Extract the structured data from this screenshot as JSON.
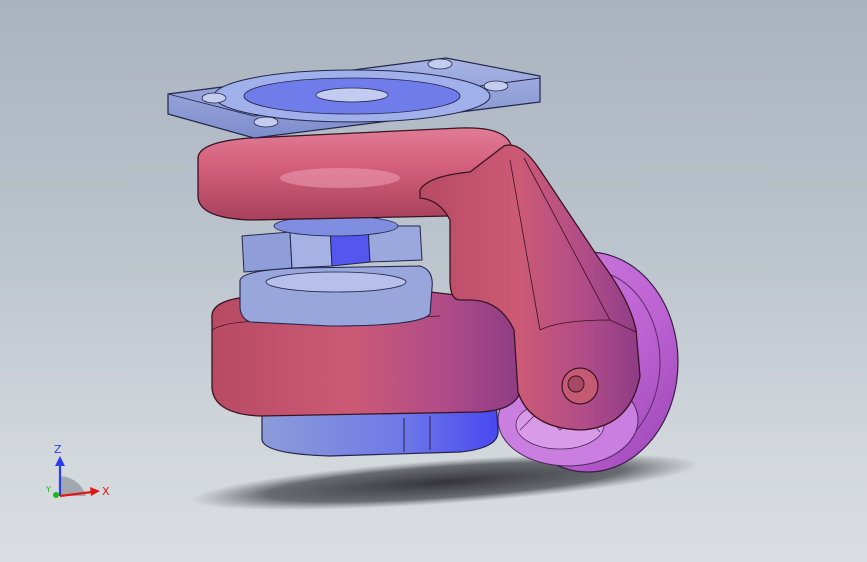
{
  "viewport": {
    "background_top": "#a9b3bf",
    "background_bottom": "#dadee2"
  },
  "model": {
    "body_color": "#c8566e",
    "wheel_color": "#c46ed8",
    "plate_color": "#8f9fd8",
    "accent_color": "#5a5cf0"
  },
  "triad": {
    "z_label": "Z",
    "y_label": "Y",
    "x_label": "X",
    "z_color": "#2b3cf0",
    "y_color": "#19b81e",
    "x_color": "#e01818"
  }
}
